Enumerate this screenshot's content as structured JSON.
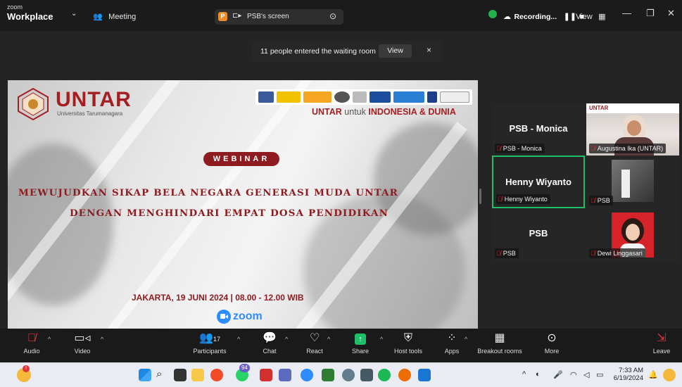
{
  "titlebar": {
    "brand_top": "zoom",
    "brand_bottom": "Workplace",
    "meeting_label": "Meeting",
    "screen_share_label": "PSB's screen",
    "recording_label": "Recording...",
    "view_label": "View"
  },
  "toast": {
    "message": "11 people entered the waiting room",
    "view_button": "View",
    "close": "×"
  },
  "slide": {
    "logo_text": "UNTAR",
    "logo_sub": "Universitas Tarumanagara",
    "tagline_a": "UNTAR",
    "tagline_b": " untuk ",
    "tagline_c": "INDONESIA & DUNIA",
    "badge": "WEBINAR",
    "headline_1": "MEWUJUDKAN SIKAP BELA NEGARA GENERASI MUDA UNTAR",
    "headline_2": "DENGAN MENGHINDARI EMPAT DOSA PENDIDIKAN",
    "date_line": "JAKARTA, 19 JUNI 2024  |  08.00 - 12.00 WIB",
    "zoom_text": "zoom"
  },
  "participants": [
    {
      "big_name": "PSB - Monica",
      "tag": "PSB - Monica"
    },
    {
      "big_name": "",
      "tag": "Augustina Ika (UNTAR)"
    },
    {
      "big_name": "Henny Wiyanto",
      "tag": "Henny Wiyanto"
    },
    {
      "big_name": "",
      "tag": "PSB"
    },
    {
      "big_name": "PSB",
      "tag": "PSB"
    },
    {
      "big_name": "",
      "tag": "Dewi Linggasari"
    }
  ],
  "toolbar": {
    "audio": "Audio",
    "video": "Video",
    "participants": "Participants",
    "participants_count": "17",
    "chat": "Chat",
    "react": "React",
    "share": "Share",
    "host_tools": "Host tools",
    "apps": "Apps",
    "breakout_rooms": "Breakout rooms",
    "more": "More",
    "leave": "Leave"
  },
  "taskbar": {
    "whatsapp_badge": "94",
    "time": "7:33 AM",
    "date": "6/19/2024"
  }
}
